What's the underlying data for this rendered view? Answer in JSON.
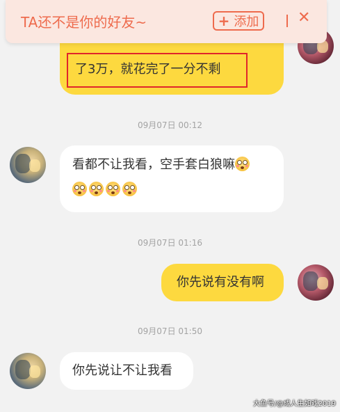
{
  "banner": {
    "title": "TA还不是你的好友~",
    "add_label": "添加",
    "close_glyph": "✕",
    "color": "#ee6b4d"
  },
  "messages": [
    {
      "side": "out",
      "text": "了3万，就花完了一分不剩"
    },
    {
      "timestamp": "09月07日 00:12"
    },
    {
      "side": "in",
      "text": "看都不让我看，空手套白狼嘛",
      "emoji_count_line1": 1,
      "emoji_count_line2": 4,
      "emoji_name": "flushed-face-icon"
    },
    {
      "timestamp": "09月07日 01:16"
    },
    {
      "side": "out",
      "text": "你先说有没有啊"
    },
    {
      "timestamp": "09月07日 01:50"
    },
    {
      "side": "in",
      "text": "你先说让不让我看"
    }
  ],
  "colors": {
    "outgoing_bubble": "#fdd93f",
    "incoming_bubble": "#ffffff",
    "background": "#f2f2f2",
    "highlight_box": "#e0252b"
  },
  "watermark": "大鱼号/@成人生如戏2019"
}
